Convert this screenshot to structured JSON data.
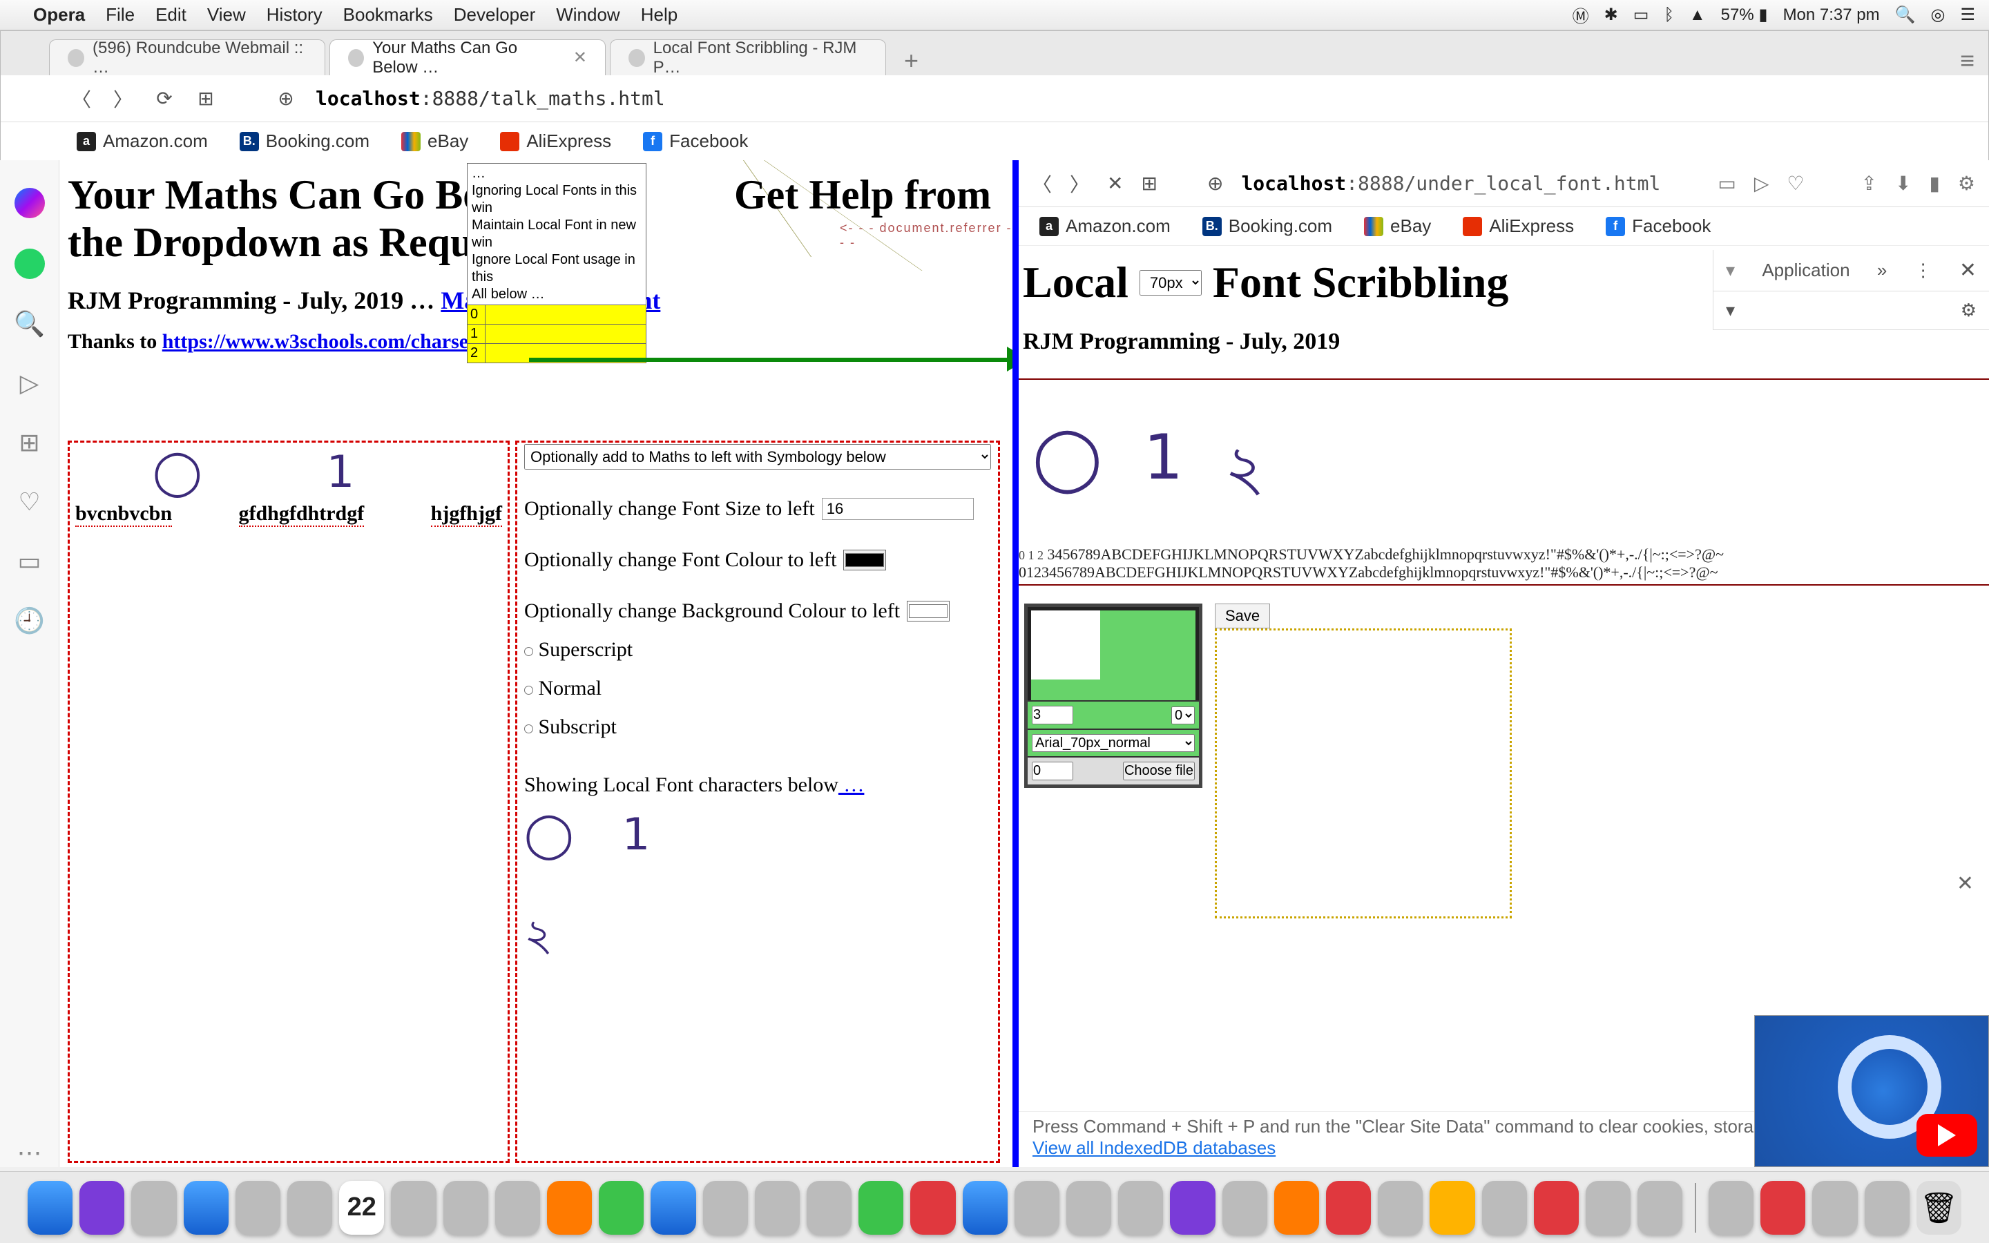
{
  "menubar": {
    "app": "Opera",
    "items": [
      "File",
      "Edit",
      "View",
      "History",
      "Bookmarks",
      "Developer",
      "Window",
      "Help"
    ],
    "battery": "57%",
    "clock": "Mon 7:37 pm"
  },
  "tabs": [
    {
      "title": "(596) Roundcube Webmail :: …",
      "active": false
    },
    {
      "title": "Your Maths Can Go Below …",
      "active": true
    },
    {
      "title": "Local Font Scribbling - RJM P…",
      "active": false
    }
  ],
  "addr_left": {
    "scheme": "",
    "host": "localhost",
    "port_path": ":8888/talk_maths.html"
  },
  "addr_right": {
    "scheme": "",
    "host": "localhost",
    "port_path": ":8888/under_local_font.html"
  },
  "bookmarks": [
    {
      "ico": "amz",
      "label": "Amazon.com"
    },
    {
      "ico": "book",
      "label": "Booking.com"
    },
    {
      "ico": "ebay",
      "label": "eBay"
    },
    {
      "ico": "ali",
      "label": "AliExpress"
    },
    {
      "ico": "fb",
      "label": "Facebook"
    }
  ],
  "yellowbox": {
    "top": "…\nIgnoring Local Fonts in this win\nMaintain Local Font in new win\nIgnore Local Font usage in this\nAll below …",
    "rows": [
      "0",
      "1",
      "2"
    ]
  },
  "left_pane": {
    "h1_a": "Your Maths Can Go Below",
    "h1_b": "Get Help from the Dropdown as Required",
    "h2_prefix": "RJM Programming - July, 2019 … ",
    "h2_link": "Maintain Local Font",
    "thanks_prefix": "Thanks to ",
    "thanks_link": "https://www.w3schools.com/charsets/ref_utf_math.asp",
    "ref_note": "<- - - document.referrer - - -",
    "scribbles": [
      "◯",
      "𝟣"
    ],
    "under_words": [
      "bvcnbvcbn",
      "gfdhgfdhtrdgf",
      "hjgfhjgf"
    ],
    "symb_select": "Optionally add to Maths to left with Symbology below",
    "fontsize_label": "Optionally change Font Size to left",
    "fontsize_value": "16",
    "fontcol_label": "Optionally change Font Colour to left",
    "fontcol_value": "#000000",
    "bgcol_label": "Optionally change Background Colour to left",
    "bgcol_value": "#ffffff",
    "radios": [
      "Superscript",
      "Normal",
      "Subscript"
    ],
    "show_local": "Showing Local Font characters below",
    "show_local_suffix": " …",
    "local_glyphs_row1": [
      "◯",
      "𝟣"
    ],
    "local_glyphs_row2": [
      "২"
    ]
  },
  "right_pane": {
    "title_a": "Local",
    "title_sel": "70px",
    "title_b": "Font Scribbling",
    "sub": "RJM Programming - July, 2019",
    "scribbles": [
      "◯",
      "𝟣",
      "২"
    ],
    "charline_tiny": "0 1 2",
    "charline1": "3456789ABCDEFGHIJKLMNOPQRSTUVWXYZabcdefghijklmnopqrstuvwxyz!\"#$%&'()*+,-./{|~:;<=>?@~",
    "charline2": "0123456789ABCDEFGHIJKLMNOPQRSTUVWXYZabcdefghijklmnopqrstuvwxyz!\"#$%&'()*+,-./{|~:;<=>?@~",
    "save": "Save",
    "tool_num": "3",
    "tool_zero_sel": "0",
    "tool_font_sel": "Arial_70px_normal",
    "tool_zero": "0",
    "tool_choose": "Choose file",
    "devtools_tab": "Application",
    "devtools_more": "»",
    "devtools_hint_top": "Press Command + Shift + P and run the \"Clear Site Data\" command to clear cookies, storage, and more.",
    "devtools_hint_link": "View all IndexedDB databases"
  },
  "dock": {
    "cal_day": "22"
  }
}
